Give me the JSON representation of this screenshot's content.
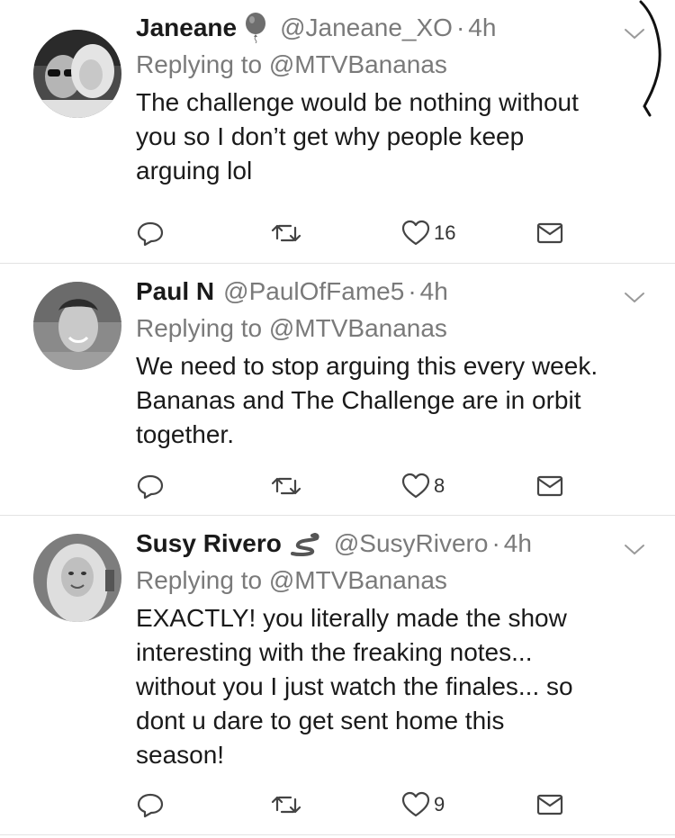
{
  "tweets": [
    {
      "name": "Janeane",
      "emoji": "balloon-icon",
      "handle": "@Janeane_XO",
      "dot": "·",
      "time": "4h",
      "reply": "Replying to @MTVBananas",
      "lines": [
        "The challenge would be nothing without",
        "you so I don’t get why people keep",
        "arguing lol"
      ],
      "like_count": "16"
    },
    {
      "name": "Paul N",
      "emoji": "",
      "handle": "@PaulOfFame5",
      "dot": "·",
      "time": "4h",
      "reply": "Replying to @MTVBananas",
      "lines": [
        "We need to stop arguing this every week.",
        "Bananas and The Challenge are in orbit",
        "together."
      ],
      "like_count": "8"
    },
    {
      "name": "Susy Rivero",
      "emoji": "snake-icon",
      "handle": "@SusyRivero",
      "dot": "·",
      "time": "4h",
      "reply": "Replying to @MTVBananas",
      "lines": [
        "EXACTLY! you literally made the show",
        "interesting with the freaking notes...",
        "without you I just watch the finales... so",
        "dont u dare to get sent home this",
        "season!"
      ],
      "like_count": "9"
    }
  ]
}
